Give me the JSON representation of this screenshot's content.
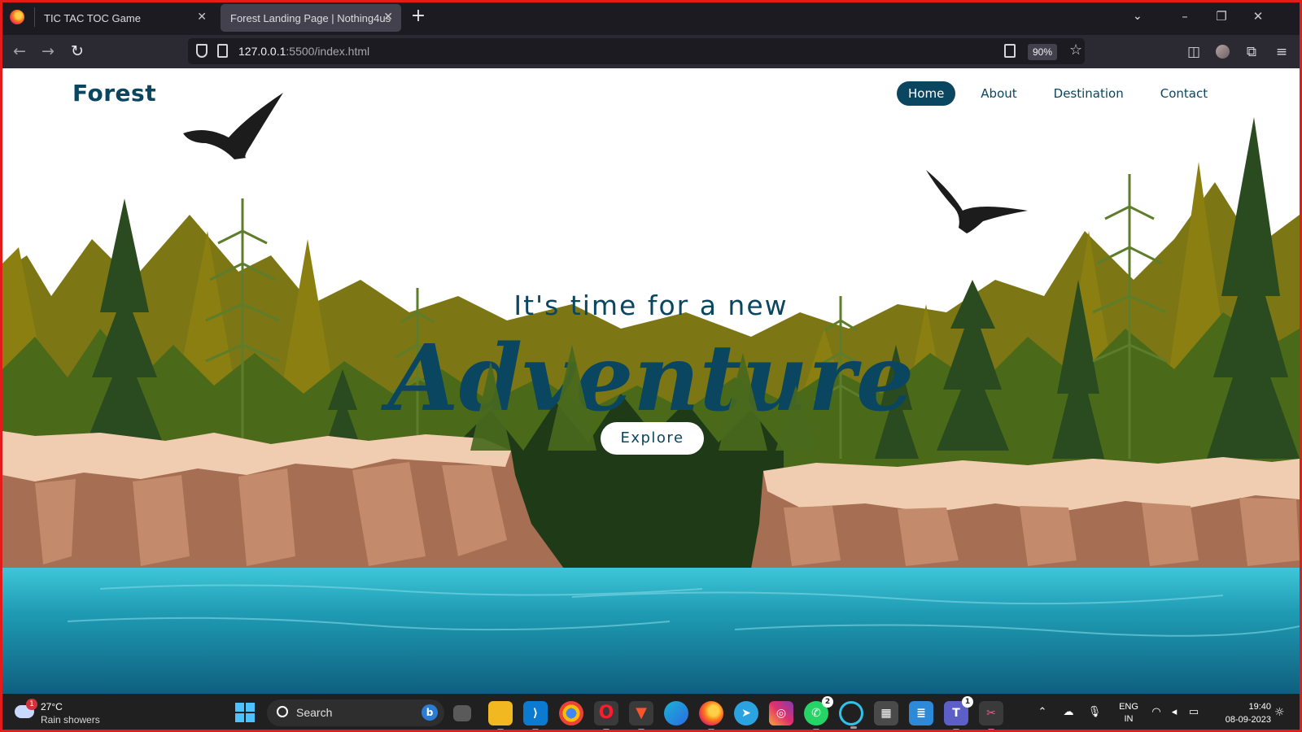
{
  "browser": {
    "tabs": [
      {
        "title": "TIC TAC TOC Game",
        "active": false
      },
      {
        "title": "Forest Landing Page | Nothing4us",
        "active": true
      }
    ],
    "new_tab": "+",
    "url_host": "127.0.0.1",
    "url_path": ":5500/index.html",
    "zoom": "90%"
  },
  "page": {
    "brand": "Forest",
    "nav": [
      {
        "label": "Home",
        "active": true
      },
      {
        "label": "About",
        "active": false
      },
      {
        "label": "Destination",
        "active": false
      },
      {
        "label": "Contact",
        "active": false
      }
    ],
    "tagline": "It's time for a new",
    "headline": "Adventure",
    "cta": "Explore",
    "colors": {
      "brand": "#0a4660",
      "water": "#1a8fa8"
    }
  },
  "taskbar": {
    "weather_temp": "27°C",
    "weather_desc": "Rain showers",
    "weather_badge": "1",
    "search_label": "Search",
    "apps": [
      {
        "name": "file-explorer",
        "badge": ""
      },
      {
        "name": "vscode",
        "badge": ""
      },
      {
        "name": "chrome",
        "badge": ""
      },
      {
        "name": "opera",
        "badge": ""
      },
      {
        "name": "brave",
        "badge": ""
      },
      {
        "name": "edge",
        "badge": ""
      },
      {
        "name": "firefox",
        "badge": ""
      },
      {
        "name": "telegram",
        "badge": ""
      },
      {
        "name": "instagram",
        "badge": ""
      },
      {
        "name": "whatsapp",
        "badge": "2"
      },
      {
        "name": "alexa",
        "badge": ""
      },
      {
        "name": "calculator",
        "badge": ""
      },
      {
        "name": "notepad",
        "badge": ""
      },
      {
        "name": "teams",
        "badge": "1"
      },
      {
        "name": "snipping-tool",
        "badge": ""
      }
    ],
    "lang_line1": "ENG",
    "lang_line2": "IN",
    "time": "19:40",
    "date": "08-09-2023"
  }
}
